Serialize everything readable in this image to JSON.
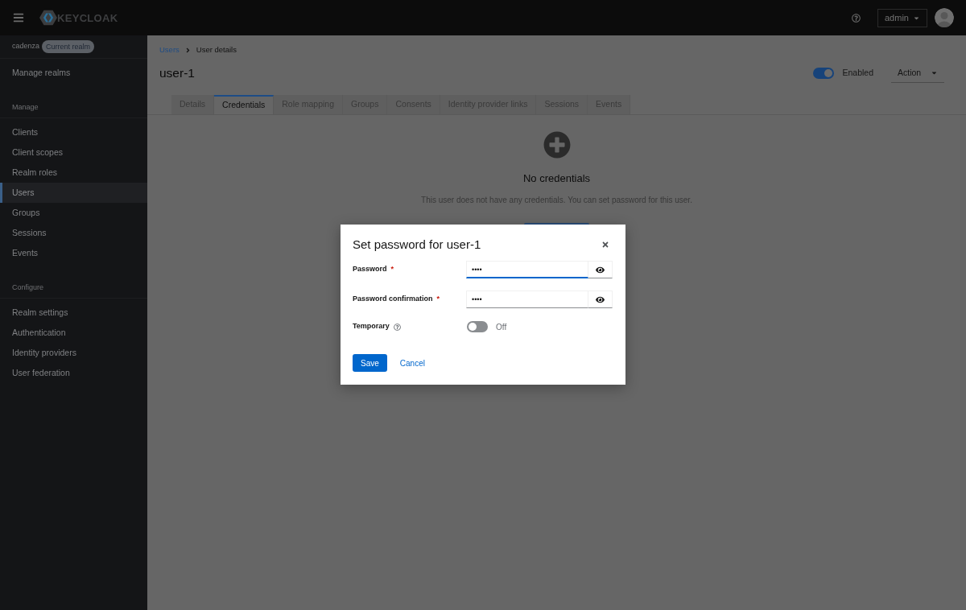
{
  "masthead": {
    "logo_text": "KEYCLOAK",
    "user_menu": "admin"
  },
  "sidebar": {
    "realm": "cadenza",
    "realm_badge": "Current realm",
    "manage_realms": "Manage realms",
    "sections": [
      {
        "heading": "Manage",
        "items": [
          {
            "label": "Clients",
            "selected": false
          },
          {
            "label": "Client scopes",
            "selected": false
          },
          {
            "label": "Realm roles",
            "selected": false
          },
          {
            "label": "Users",
            "selected": true
          },
          {
            "label": "Groups",
            "selected": false
          },
          {
            "label": "Sessions",
            "selected": false
          },
          {
            "label": "Events",
            "selected": false
          }
        ]
      },
      {
        "heading": "Configure",
        "items": [
          {
            "label": "Realm settings",
            "selected": false
          },
          {
            "label": "Authentication",
            "selected": false
          },
          {
            "label": "Identity providers",
            "selected": false
          },
          {
            "label": "User federation",
            "selected": false
          }
        ]
      }
    ]
  },
  "breadcrumb": [
    {
      "label": "Users",
      "kind": "link"
    },
    {
      "label": "User details",
      "kind": "current"
    }
  ],
  "page": {
    "title": "user-1",
    "enabled_toggle": {
      "label": "Enabled",
      "on": true
    },
    "action_menu": "Action"
  },
  "tabs": [
    {
      "label": "Details",
      "selected": false
    },
    {
      "label": "Credentials",
      "selected": true
    },
    {
      "label": "Role mapping",
      "selected": false
    },
    {
      "label": "Groups",
      "selected": false
    },
    {
      "label": "Consents",
      "selected": false
    },
    {
      "label": "Identity provider links",
      "selected": false
    },
    {
      "label": "Sessions",
      "selected": false
    },
    {
      "label": "Events",
      "selected": false
    }
  ],
  "empty_state": {
    "title": "No credentials",
    "description": "This user does not have any credentials. You can set password for this user."
  },
  "dialog": {
    "title": "Set password for user-1",
    "fields": [
      {
        "label": "Password",
        "required_mark": "*",
        "value": "••••",
        "focused": true
      },
      {
        "label": "Password confirmation",
        "required_mark": "*",
        "value": "••••",
        "focused": false
      }
    ],
    "temporary": {
      "label": "Temporary",
      "on": false,
      "state_label": "Off"
    },
    "buttons": [
      {
        "label": "Save",
        "kind": "primary"
      },
      {
        "label": "Cancel",
        "kind": "link"
      }
    ]
  }
}
